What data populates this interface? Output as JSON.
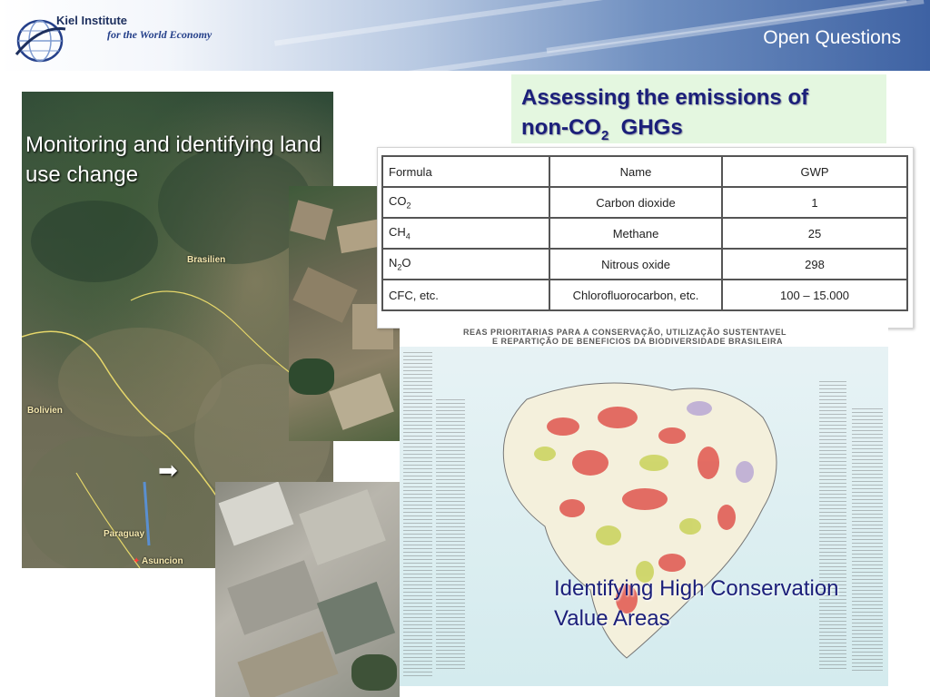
{
  "header": {
    "org_name": "Kiel Institute",
    "org_tagline": "for the World Economy",
    "slide_title": "Open Questions"
  },
  "monitoring": {
    "caption": "Monitoring and identifying land use change",
    "map_labels": [
      "Brasilien",
      "Bolivien",
      "Paraguay",
      "Asuncion"
    ],
    "arrow": "➡"
  },
  "ghg": {
    "title_line1": "Assessing the emissions of",
    "title_line2_prefix": "non-CO",
    "title_line2_sub": "2",
    "title_line2_suffix": "  GHGs"
  },
  "gwp_table": {
    "headers": [
      "Formula",
      "Name",
      "GWP"
    ],
    "rows": [
      {
        "formula": "CO",
        "formula_sub": "2",
        "name": "Carbon dioxide",
        "gwp": "1"
      },
      {
        "formula": "CH",
        "formula_sub": "4",
        "name": "Methane",
        "gwp": "25"
      },
      {
        "formula": "N",
        "formula_sub": "2",
        "formula_suffix": "O",
        "name": "Nitrous oxide",
        "gwp": "298"
      },
      {
        "formula": "CFC, etc.",
        "formula_sub": "",
        "name": "Chlorofluorocarbon, etc.",
        "gwp": "100 – 15.000"
      }
    ]
  },
  "hcv": {
    "banner_line1": "REAS PRIORITARIAS PARA A CONSERVAÇÃO, UTILIZAÇÃO SUSTENTAVEL",
    "banner_line2": "E REPARTIÇÃO DE BENEFICIOS DA BIODIVERSIDADE BRASILEIRA",
    "caption": "Identifying High Conservation Value Areas"
  }
}
